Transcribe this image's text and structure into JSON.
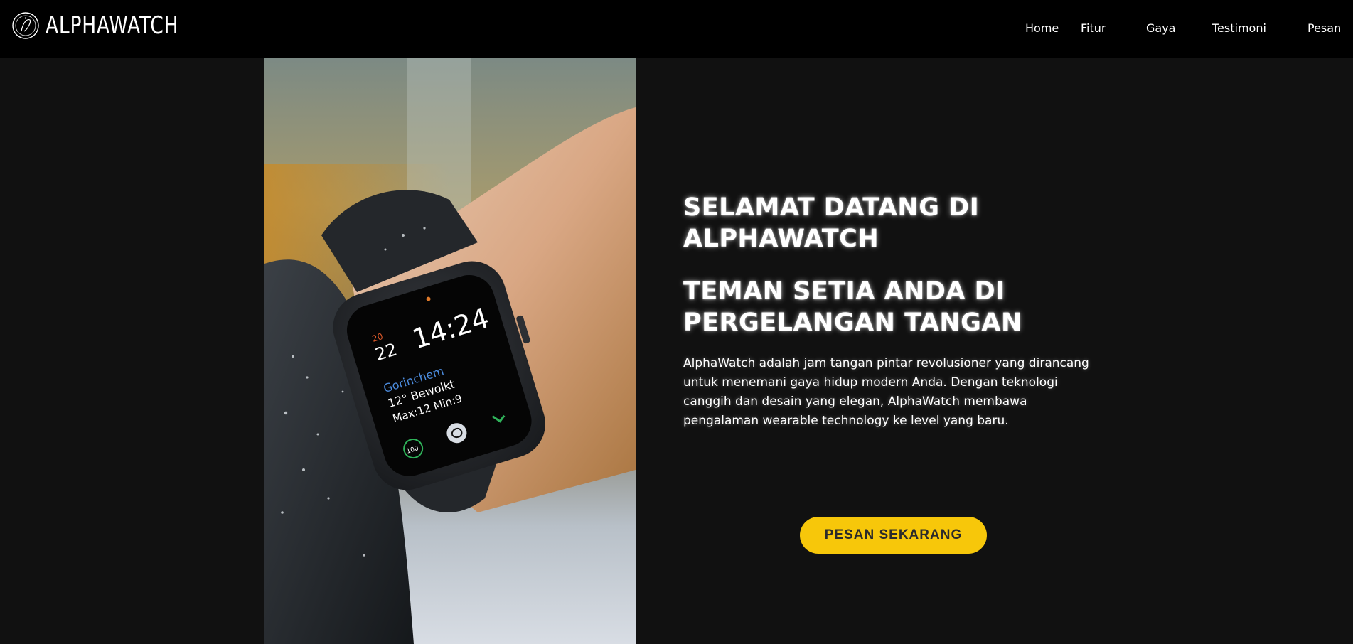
{
  "brand": {
    "logo_icon": "watch-circle-logo",
    "name": "ALPHAWATCH"
  },
  "nav": {
    "items": [
      {
        "label": "Home"
      },
      {
        "label": "Fitur"
      },
      {
        "label": "Gaya"
      },
      {
        "label": "Testimoni"
      },
      {
        "label": "Pesan"
      }
    ]
  },
  "hero": {
    "image_alt": "smartwatch-on-wrist",
    "watch_screen": {
      "day_label": "20",
      "date": "22",
      "time": "14:24",
      "location": "Gorinchem",
      "weather": "12° Bewolkt",
      "maxmin": "Max:12 Min:9",
      "ring_value": "100"
    },
    "title": "SELAMAT DATANG DI ALPHAWATCH",
    "subtitle": "TEMAN SETIA ANDA DI PERGELANGAN TANGAN",
    "description": "AlphaWatch adalah jam tangan pintar revolusioner yang dirancang untuk menemani gaya hidup modern Anda. Dengan teknologi canggih dan desain yang elegan, AlphaWatch membawa pengalaman wearable technology ke level yang baru.",
    "cta_label": "PESAN SEKARANG"
  },
  "colors": {
    "navbar_bg": "#000000",
    "page_bg": "#111111",
    "accent": "#f7c70a",
    "text": "#ffffff"
  }
}
